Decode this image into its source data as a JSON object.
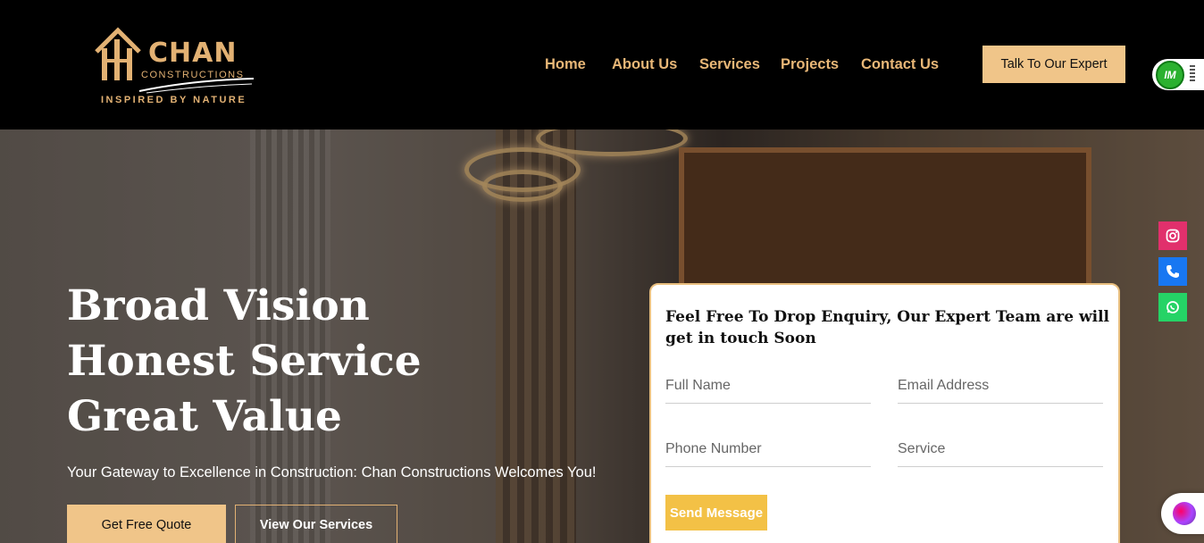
{
  "header": {
    "logo": {
      "name": "CHAN",
      "sub": "CONSTRUCTIONS",
      "tagline": "INSPIRED BY NATURE"
    },
    "nav": [
      {
        "label": "Home"
      },
      {
        "label": "About Us"
      },
      {
        "label": "Services"
      },
      {
        "label": "Projects"
      },
      {
        "label": "Contact Us"
      }
    ],
    "cta_label": "Talk To Our Expert",
    "widget_label": "IM"
  },
  "hero": {
    "headline": [
      "Broad Vision",
      "Honest Service",
      "Great Value"
    ],
    "subline": "Your Gateway to Excellence in Construction: Chan Constructions Welcomes You!",
    "quote_button": "Get Free Quote",
    "services_button": "View Our Services"
  },
  "form": {
    "title": "Feel Free To Drop Enquiry, Our Expert Team are will get in touch Soon",
    "full_name_placeholder": "Full Name",
    "email_placeholder": "Email Address",
    "phone_placeholder": "Phone Number",
    "service_placeholder": "Service",
    "send_label": "Send Message"
  },
  "social": [
    {
      "icon": "instagram-icon",
      "color": "#e1306c"
    },
    {
      "icon": "phone-icon",
      "color": "#1877f2"
    },
    {
      "icon": "whatsapp-icon",
      "color": "#25d366"
    }
  ],
  "colors": {
    "accent": "#f0c589",
    "gold": "#e2b173",
    "send": "#f3c146"
  }
}
